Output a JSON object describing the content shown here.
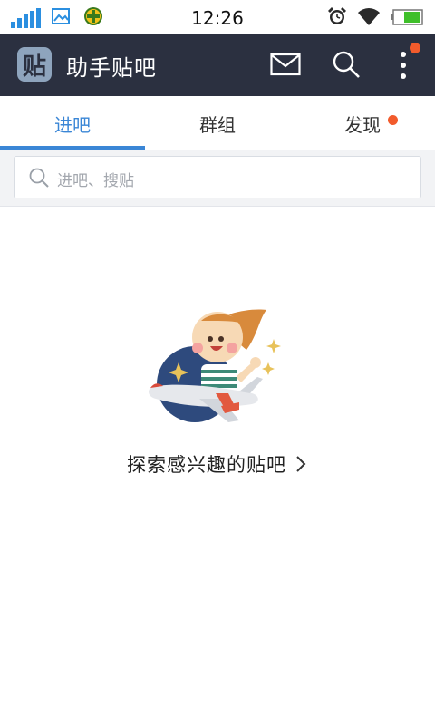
{
  "status_bar": {
    "time": "12:26",
    "icons": [
      "signal-icon",
      "gallery-icon",
      "plus-badge-icon",
      "alarm-icon",
      "wifi-icon",
      "battery-icon"
    ]
  },
  "app_bar": {
    "logo_glyph": "贴",
    "title": "助手贴吧",
    "icons": [
      "mail-icon",
      "search-icon",
      "more-icon"
    ],
    "notification_dot_color": "#f25b2c"
  },
  "tabs": [
    {
      "label": "进吧",
      "active": true
    },
    {
      "label": "群组",
      "active": false
    },
    {
      "label": "发现",
      "active": false,
      "has_dot": true
    }
  ],
  "search": {
    "placeholder": "进吧、搜贴"
  },
  "empty_state": {
    "link_text": "探索感兴趣的贴吧"
  },
  "colors": {
    "app_bar_bg": "#2b3040",
    "accent": "#3a86d6",
    "badge": "#f25b2c"
  }
}
